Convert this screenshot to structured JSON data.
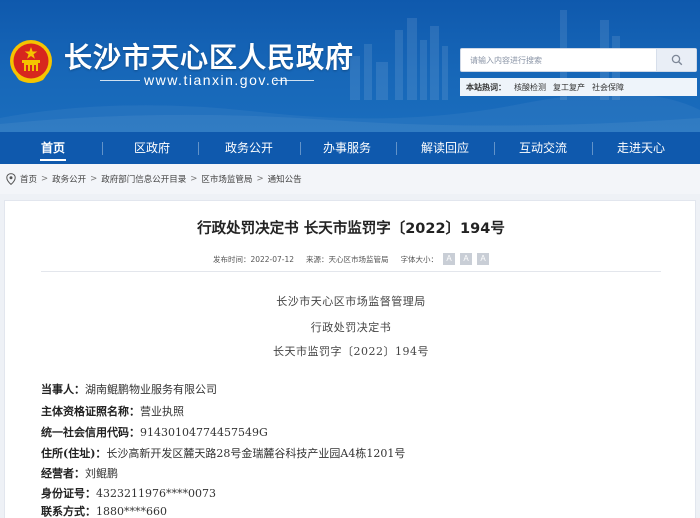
{
  "header": {
    "site_title": "长沙市天心区人民政府",
    "site_url": "www.tianxin.gov.cn",
    "search": {
      "placeholder": "请输入内容进行搜索",
      "button_icon": "search-icon"
    },
    "hotwords": {
      "label": "本站热词：",
      "words": [
        "核酸检测",
        "复工复产",
        "社会保障"
      ]
    }
  },
  "nav": {
    "items": [
      {
        "label": "首页",
        "active": true
      },
      {
        "label": "区政府"
      },
      {
        "label": "政务公开"
      },
      {
        "label": "办事服务"
      },
      {
        "label": "解读回应"
      },
      {
        "label": "互动交流"
      },
      {
        "label": "走进天心"
      }
    ]
  },
  "breadcrumb": {
    "items": [
      "首页",
      "政务公开",
      "政府部门信息公开目录",
      "区市场监管局",
      "通知公告"
    ]
  },
  "article": {
    "title": "行政处罚决定书 长天市监罚字〔2022〕194号",
    "publish_time": "发布时间：2022-07-12",
    "source": "来源：天心区市场监管局",
    "font_size_label": "字体大小：",
    "font_size_buttons": [
      "A",
      "A",
      "A"
    ],
    "heading_lines": [
      "长沙市天心区市场监督管理局",
      "行政处罚决定书",
      "长天市监罚字〔2022〕194号"
    ],
    "fields": [
      {
        "label": "当事人：",
        "value": "湖南鲲鹏物业服务有限公司"
      },
      {
        "label": "主体资格证照名称：",
        "value": "营业执照"
      },
      {
        "label": "统一社会信用代码：",
        "value": "91430104774457549G"
      },
      {
        "label": "住所(住址)：",
        "value": "长沙高新开发区麓天路28号金瑞麓谷科技产业园A4栋1201号"
      },
      {
        "label": "经营者：",
        "value": "刘鲲鹏"
      },
      {
        "label": "身份证号：",
        "value": "4323211976****0073"
      },
      {
        "label": "联系方式：",
        "value": "1880****660"
      }
    ]
  },
  "colors": {
    "banner_blue": "#1767b8",
    "nav_blue": "#0f59ad",
    "emblem_red": "#d7261e",
    "emblem_gold": "#f5c400"
  }
}
